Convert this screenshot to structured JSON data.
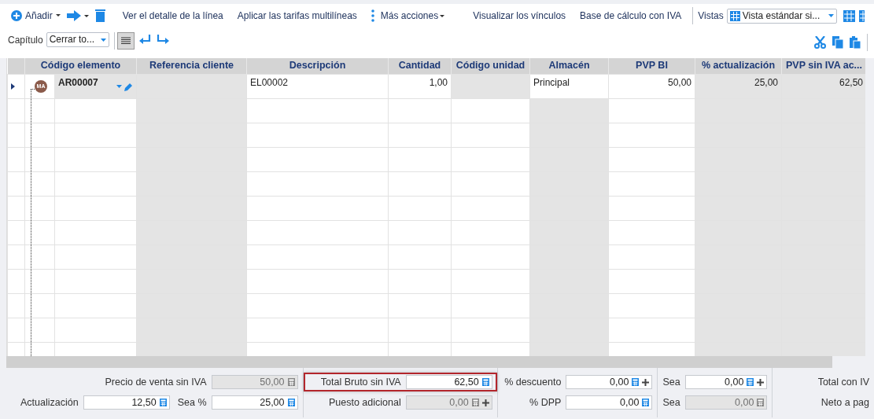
{
  "toolbar": {
    "add_label": "Añadir",
    "actions": [
      "Ver el detalle de la línea",
      "Aplicar las tarifas multilíneas"
    ],
    "more_label": "Más acciones",
    "actions_right": [
      "Visualizar los vínculos",
      "Base de cálculo con IVA"
    ],
    "views_label": "Vistas",
    "view_value": "Vista estándar si..."
  },
  "subtoolbar": {
    "chapter_label": "Capítulo",
    "chapter_value": "Cerrar to...",
    "list_view_selected": true
  },
  "table": {
    "columns": [
      {
        "label": "Código elemento",
        "shaded": false
      },
      {
        "label": "Referencia cliente",
        "shaded": true
      },
      {
        "label": "Descripción",
        "shaded": false
      },
      {
        "label": "Cantidad",
        "shaded": false
      },
      {
        "label": "Código unidad",
        "shaded": false
      },
      {
        "label": "Almacén",
        "shaded": true
      },
      {
        "label": "PVP BI",
        "shaded": false
      },
      {
        "label": "% actualización",
        "shaded": true
      },
      {
        "label": "PVP sin IVA ac...",
        "shaded": true
      }
    ],
    "rows": [
      {
        "selected": true,
        "avatar": "MA",
        "cells": [
          {
            "text": "AR00007",
            "shaded": true
          },
          {
            "text": "",
            "shaded": true
          },
          {
            "text": "EL00002",
            "shaded": false
          },
          {
            "text": "1,00",
            "shaded": false
          },
          {
            "text": "",
            "shaded": true
          },
          {
            "text": "Principal",
            "shaded": false
          },
          {
            "text": "50,00",
            "shaded": false
          },
          {
            "text": "25,00",
            "shaded": true
          },
          {
            "text": "62,50",
            "shaded": true
          }
        ]
      }
    ]
  },
  "form": {
    "groups": [
      {
        "rows": [
          [
            {
              "label": "Precio de venta sin IVA",
              "value": "50,00",
              "disabled": true,
              "plus": false,
              "highlighted": false
            }
          ],
          [
            {
              "label": "Actualización",
              "value": "12,50",
              "disabled": false,
              "plus": false,
              "highlighted": false
            },
            {
              "label": "Sea %",
              "value": "25,00",
              "disabled": false,
              "plus": false,
              "highlighted": false
            }
          ]
        ]
      },
      {
        "rows": [
          [
            {
              "label": "Total Bruto sin IVA",
              "value": "62,50",
              "disabled": false,
              "plus": false,
              "highlighted": true
            }
          ],
          [
            {
              "label": "Puesto adicional",
              "value": "0,00",
              "disabled": true,
              "plus": true,
              "highlighted": false
            }
          ]
        ]
      },
      {
        "rows": [
          [
            {
              "label": "% descuento",
              "value": "0,00",
              "disabled": false,
              "plus": true,
              "highlighted": false
            }
          ],
          [
            {
              "label": "% DPP",
              "value": "0,00",
              "disabled": false,
              "plus": false,
              "highlighted": false
            }
          ]
        ]
      },
      {
        "rows": [
          [
            {
              "label": "Sea",
              "value": "0,00",
              "disabled": false,
              "plus": true,
              "highlighted": false
            }
          ],
          [
            {
              "label": "Sea",
              "value": "0,00",
              "disabled": true,
              "plus": false,
              "highlighted": false
            }
          ]
        ]
      },
      {
        "rows": [
          [
            {
              "label": "Total con IV"
            }
          ],
          [
            {
              "label": "Neto a pag"
            }
          ]
        ]
      }
    ]
  }
}
